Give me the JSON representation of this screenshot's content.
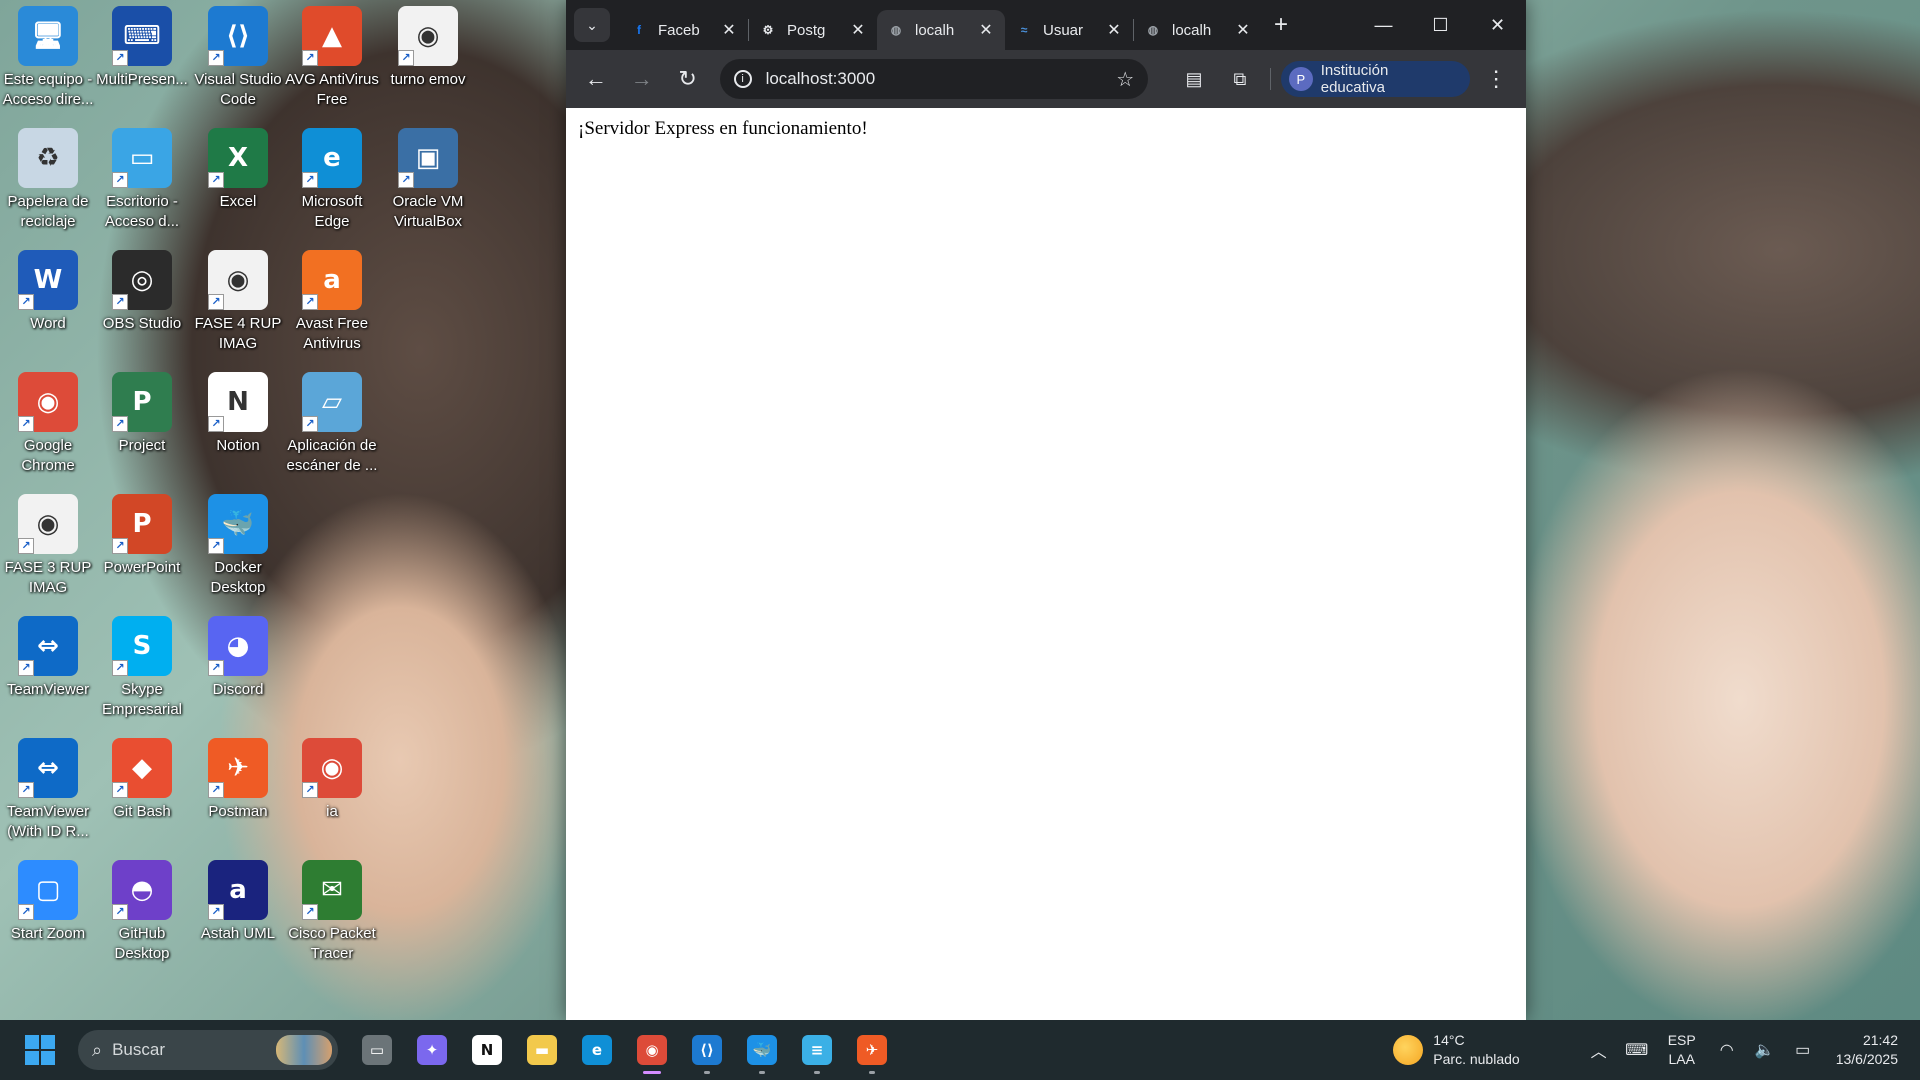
{
  "desktop": {
    "icons": [
      {
        "label": "Este equipo - Acceso dire...",
        "glyph": "🖥",
        "color": "#2a8ad8"
      },
      {
        "label": "MultiPresen...",
        "glyph": "⌨",
        "color": "#1a4fa8"
      },
      {
        "label": "Visual Studio Code",
        "glyph": "⟨⟩",
        "color": "#1d7ad1"
      },
      {
        "label": "AVG AntiVirus Free",
        "glyph": "▲",
        "color": "#e04b2b"
      },
      {
        "label": "turno emov",
        "glyph": "◉",
        "color": "#f2f2f2"
      },
      {
        "label": "Papelera de reciclaje",
        "glyph": "♻",
        "color": "#c8d7e4"
      },
      {
        "label": "Escritorio - Acceso d...",
        "glyph": "▭",
        "color": "#3aa5e5"
      },
      {
        "label": "Excel",
        "glyph": "X",
        "color": "#1f7a47"
      },
      {
        "label": "Microsoft Edge",
        "glyph": "e",
        "color": "#0f8fd6"
      },
      {
        "label": "Oracle VM VirtualBox",
        "glyph": "▣",
        "color": "#3a6fa5"
      },
      {
        "label": "Word",
        "glyph": "W",
        "color": "#1f5bb9"
      },
      {
        "label": "OBS Studio",
        "glyph": "◎",
        "color": "#2b2b2b"
      },
      {
        "label": "FASE 4 RUP IMAG",
        "glyph": "◉",
        "color": "#f2f2f2"
      },
      {
        "label": "Avast Free Antivirus",
        "glyph": "a",
        "color": "#f27022"
      },
      {
        "label": "Google Chrome",
        "glyph": "◉",
        "color": "#dd4b39"
      },
      {
        "label": "Project",
        "glyph": "P",
        "color": "#2f7d4f"
      },
      {
        "label": "Notion",
        "glyph": "N",
        "color": "#ffffff"
      },
      {
        "label": "Aplicación de escáner de ...",
        "glyph": "▱",
        "color": "#5ba6d8"
      },
      {
        "label": "FASE 3 RUP IMAG",
        "glyph": "◉",
        "color": "#f2f2f2"
      },
      {
        "label": "PowerPoint",
        "glyph": "P",
        "color": "#d24726"
      },
      {
        "label": "Docker Desktop",
        "glyph": "🐳",
        "color": "#1d91e6"
      },
      {
        "label": "TeamViewer",
        "glyph": "⇔",
        "color": "#0e6ac7"
      },
      {
        "label": "Skype Empresarial",
        "glyph": "S",
        "color": "#00aff0"
      },
      {
        "label": "Discord",
        "glyph": "◕",
        "color": "#5865f2"
      },
      {
        "label": "TeamViewer (With ID R...",
        "glyph": "⇔",
        "color": "#0e6ac7"
      },
      {
        "label": "Git Bash",
        "glyph": "◆",
        "color": "#e94e31"
      },
      {
        "label": "Postman",
        "glyph": "✈",
        "color": "#ef5b25"
      },
      {
        "label": "ia",
        "glyph": "◉",
        "color": "#dd4b39"
      },
      {
        "label": "Start Zoom",
        "glyph": "▢",
        "color": "#2d8cff"
      },
      {
        "label": "GitHub Desktop",
        "glyph": "◓",
        "color": "#6e40c9"
      },
      {
        "label": "Astah UML",
        "glyph": "a",
        "color": "#1a237e"
      },
      {
        "label": "Cisco Packet Tracer",
        "glyph": "✉",
        "color": "#2e7d32"
      }
    ]
  },
  "browser": {
    "tabs": [
      {
        "title": "Faceb",
        "icon": "facebook-icon",
        "favtext": "f",
        "favcolor": "#1877f2"
      },
      {
        "title": "Postg",
        "icon": "chatgpt-icon",
        "favtext": "⚙",
        "favcolor": "#e8eaed"
      },
      {
        "title": "localh",
        "icon": "globe-icon",
        "favtext": "◍",
        "favcolor": "#9aa0a6"
      },
      {
        "title": "Usuar",
        "icon": "dbeaver-icon",
        "favtext": "≈",
        "favcolor": "#4a90d9"
      },
      {
        "title": "localh",
        "icon": "globe-icon",
        "favtext": "◍",
        "favcolor": "#9aa0a6"
      }
    ],
    "active_tab": 2,
    "url": "localhost:3000",
    "profile_initial": "P",
    "profile_name": "Institución educativa",
    "page_text": "¡Servidor Express en funcionamiento!"
  },
  "taskbar": {
    "search_placeholder": "Buscar",
    "apps": [
      {
        "name": "task-view",
        "glyph": "▭",
        "color": "#6b7478",
        "running": false
      },
      {
        "name": "copilot",
        "glyph": "✦",
        "color": "#7b68ee",
        "running": false
      },
      {
        "name": "notion",
        "glyph": "N",
        "color": "#ffffff",
        "running": false
      },
      {
        "name": "file-explorer",
        "glyph": "▬",
        "color": "#f2c94c",
        "running": false
      },
      {
        "name": "edge",
        "glyph": "e",
        "color": "#0f8fd6",
        "running": false
      },
      {
        "name": "chrome",
        "glyph": "◉",
        "color": "#dd4b39",
        "running": true,
        "active": true
      },
      {
        "name": "vscode",
        "glyph": "⟨⟩",
        "color": "#1d7ad1",
        "running": true
      },
      {
        "name": "docker",
        "glyph": "🐳",
        "color": "#1d91e6",
        "running": true
      },
      {
        "name": "notepad",
        "glyph": "≡",
        "color": "#3bb0e6",
        "running": true
      },
      {
        "name": "postman",
        "glyph": "✈",
        "color": "#ef5b25",
        "running": true
      }
    ],
    "weather_temp": "14°C",
    "weather_desc": "Parc. nublado",
    "lang_line1": "ESP",
    "lang_line2": "LAA",
    "time": "21:42",
    "date": "13/6/2025"
  }
}
